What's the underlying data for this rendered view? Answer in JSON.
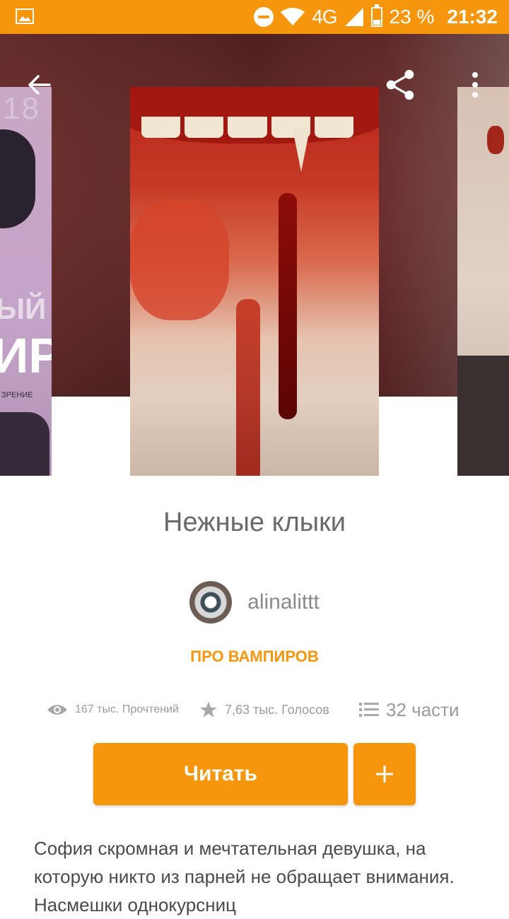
{
  "status_bar": {
    "network": "4G",
    "battery": "23 %",
    "time": "21:32"
  },
  "colors": {
    "accent": "#f5960d",
    "text_gray": "#6a6a6a"
  },
  "covers": {
    "left": {
      "number": "18",
      "title_line1": "ЫЙ",
      "title_line2": "ИР",
      "subtitle": "ЗРЕНИЕ"
    }
  },
  "story": {
    "title": "Нежные клыки",
    "author": "alinalittt",
    "tag": "ПРО ВАМПИРОВ",
    "stats": {
      "reads": "167 тыс. Прочтений",
      "votes": "7,63 тыс. Голосов",
      "parts": "32 части"
    },
    "read_label": "Читать",
    "add_label": "+",
    "description": "София скромная и мечтательная девушка, на которую никто из парней не обращает внимания. Насмешки однокурсниц"
  },
  "icons": [
    "image-icon",
    "do-not-disturb-icon",
    "wifi-icon",
    "signal-icon",
    "battery-icon",
    "back-arrow-icon",
    "share-icon",
    "more-vert-icon",
    "eye-icon",
    "star-icon",
    "list-icon"
  ]
}
